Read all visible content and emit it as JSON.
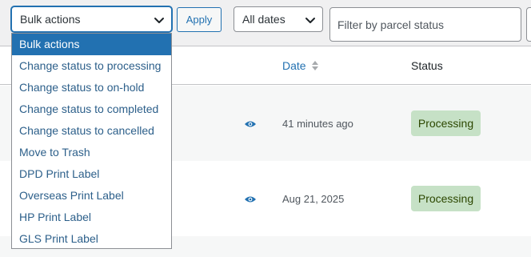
{
  "toolbar": {
    "bulk_select_value": "Bulk actions",
    "apply_label": "Apply",
    "dates_select_value": "All dates",
    "filter_placeholder": "Filter by parcel status"
  },
  "bulk_options": [
    "Bulk actions",
    "Change status to processing",
    "Change status to on-hold",
    "Change status to completed",
    "Change status to cancelled",
    "Move to Trash",
    "DPD Print Label",
    "Overseas Print Label",
    "HP Print Label",
    "GLS Print Label"
  ],
  "table": {
    "columns": {
      "date": "Date",
      "status": "Status"
    },
    "rows": [
      {
        "date": "41 minutes ago",
        "status": "Processing"
      },
      {
        "date": "Aug 21, 2025",
        "status": "Processing"
      }
    ]
  },
  "colors": {
    "accent": "#2271b1",
    "processing_badge_bg": "#c6e1c6",
    "processing_badge_text": "#2c4700"
  },
  "icons": [
    "chevron-down-icon",
    "sort-icon",
    "eye-icon"
  ]
}
